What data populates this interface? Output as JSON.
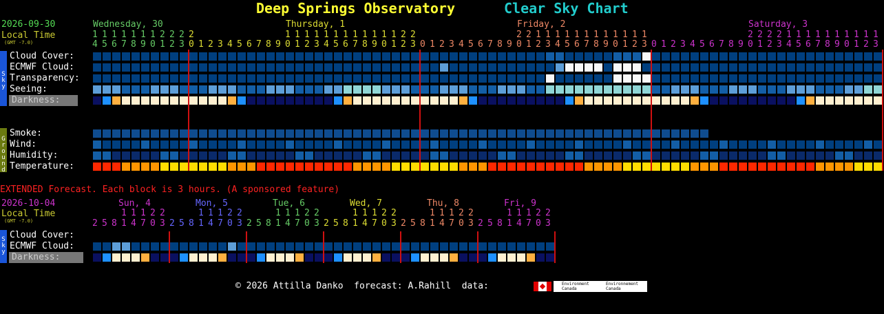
{
  "header": {
    "title": "Deep Springs Observatory",
    "subtitle": "Clear Sky Chart",
    "title_color": "#ffff33",
    "subtitle_color": "#22cccc"
  },
  "hourly": {
    "date": "2026-09-30",
    "local_time": "Local Time",
    "gmt": "(GMT -7.0)",
    "days": [
      {
        "label": "Wednesday, 30",
        "color": "#66cc66"
      },
      {
        "label": "Thursday, 1",
        "color": "#dddd33"
      },
      {
        "label": "Friday, 2",
        "color": "#ee8866"
      },
      {
        "label": "Saturday, 3",
        "color": "#cc33cc"
      }
    ],
    "tens_row": "11111112222 1111111111112222 1111111111112222 1111111111112222",
    "ones_row": "4567890123012345678901234567890123012345678901234567890123012345678901234567890123",
    "sky_tab": "Sky",
    "ground_tab": "Ground",
    "sky_labels": [
      "Cloud Cover:",
      "ECMWF Cloud:",
      "Transparency:",
      "Seeing:"
    ],
    "darkness_label": "Darkness:",
    "ground_labels": [
      "Smoke:",
      "Wind:",
      "Humidity:",
      "Temperature:"
    ]
  },
  "extended": {
    "banner": "EXTENDED Forecast. Each block is 3 hours. (A sponsored feature)",
    "date": "2026-10-04",
    "local_time": "Local Time",
    "gmt": "(GMT -7.0)",
    "days": [
      {
        "label": "Sun, 4",
        "color": "#cc33cc"
      },
      {
        "label": "Mon, 5",
        "color": "#6666ff"
      },
      {
        "label": "Tue, 6",
        "color": "#66cc66"
      },
      {
        "label": "Wed, 7",
        "color": "#dddd33"
      },
      {
        "label": "Thu, 8",
        "color": "#ee8866"
      },
      {
        "label": "Fri, 9",
        "color": "#cc33cc"
      }
    ],
    "tens_row": "11122",
    "ones_row": "258147032581470325814703258147032581470325814703",
    "sky_tab": "Sky",
    "sky_labels": [
      "Cloud Cover:",
      "ECMWF Cloud:"
    ],
    "darkness_label": "Darkness:"
  },
  "footer": {
    "text": "© 2026 Attilla Danko  forecast: A.Rahill  data:",
    "logo1": "Environment Canada",
    "logo2": "Environnement Canada"
  },
  "colors": {
    "sky_dark": "#003f7f",
    "sky_mid": "#135ea6",
    "sky_light": "#5d9ed8",
    "cloud_white": "#f8f8f8",
    "smoke_blue": "#0f4c8f",
    "temp_red": "#ff2800",
    "temp_orange": "#ff9600",
    "temp_yellow": "#ffdd00",
    "midnight_line": "#d01010",
    "local_time_color": "#cccc33",
    "date_color": "#55dd55",
    "banner_color": "#ff2222"
  }
}
